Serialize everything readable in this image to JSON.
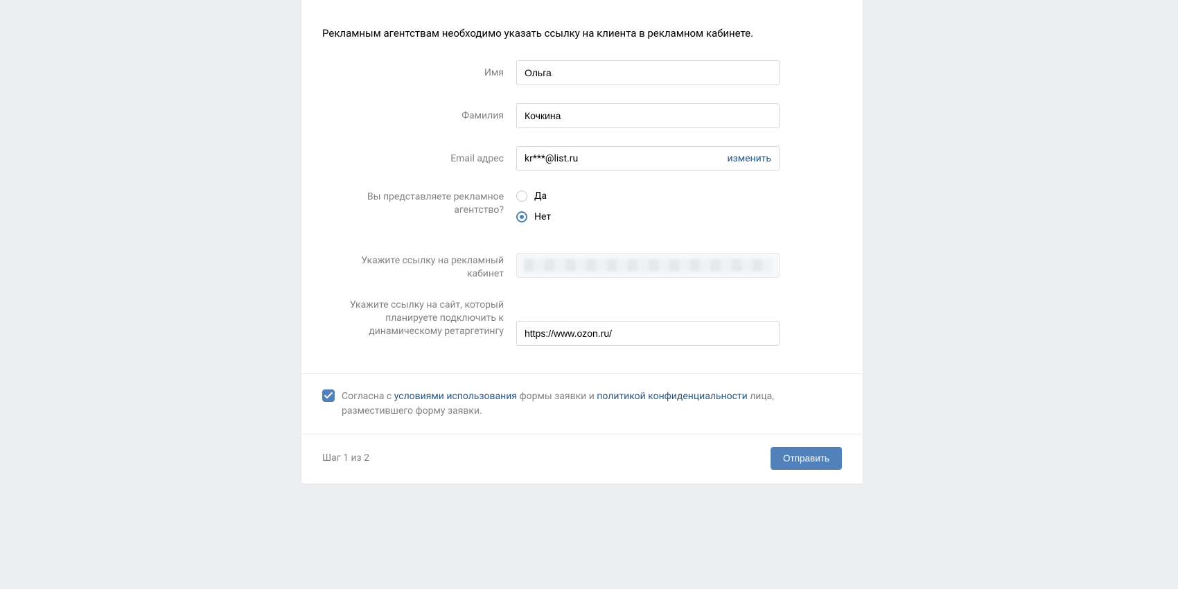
{
  "intro": "Рекламным агентствам необходимо указать ссылку на клиента в рекламном кабинете.",
  "fields": {
    "first_name": {
      "label": "Имя",
      "value": "Ольга"
    },
    "last_name": {
      "label": "Фамилия",
      "value": "Кочкина"
    },
    "email": {
      "label": "Email адрес",
      "value": "kr***@list.ru",
      "change": "изменить"
    },
    "agency": {
      "label": "Вы представляете рекламное агентство?",
      "options": {
        "yes": "Да",
        "no": "Нет"
      },
      "selected": "no"
    },
    "cabinet_link": {
      "label": "Укажите ссылку на рекламный кабинет",
      "value": ""
    },
    "site_link": {
      "label": "Укажите ссылку на сайт, который планируете подключить к динамическому ретаргетингу",
      "value": "https://www.ozon.ru/"
    }
  },
  "consent": {
    "prefix": "Согласна с ",
    "terms_link": "условиями использования",
    "mid1": " формы заявки и ",
    "privacy_link": "политикой конфиденциальности",
    "suffix": " лица, разместившего форму заявки."
  },
  "footer": {
    "step": "Шаг 1 из 2",
    "submit": "Отправить"
  }
}
